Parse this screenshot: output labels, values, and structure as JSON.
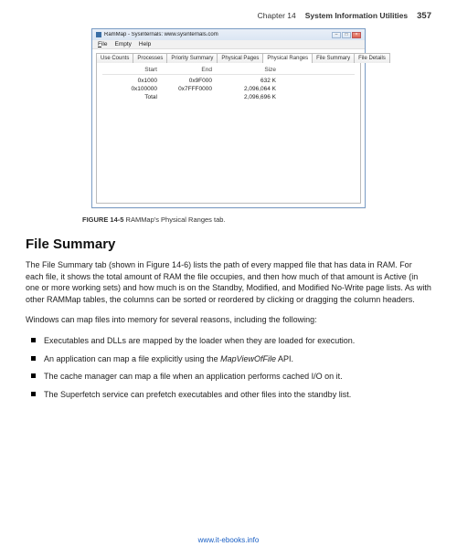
{
  "header": {
    "chapter": "Chapter 14",
    "title": "System Information Utilities",
    "page": "357"
  },
  "app": {
    "title": "RamMap - Sysinternals: www.sysinternals.com",
    "menus": {
      "file": "File",
      "empty": "Empty",
      "help": "Help"
    },
    "tabs": {
      "use_counts": "Use Counts",
      "processes": "Processes",
      "priority_summary": "Priority Summary",
      "physical_pages": "Physical Pages",
      "physical_ranges": "Physical Ranges",
      "file_summary": "File Summary",
      "file_details": "File Details"
    },
    "table": {
      "headers": {
        "start": "Start",
        "end": "End",
        "size": "Size"
      },
      "rows": [
        {
          "start": "0x1000",
          "end": "0x9F000",
          "size": "632 K"
        },
        {
          "start": "0x100000",
          "end": "0x7FFF0000",
          "size": "2,096,064 K"
        },
        {
          "start": "Total",
          "end": "",
          "size": "2,096,696 K"
        }
      ]
    }
  },
  "caption": {
    "label": "FIGURE 14-5",
    "text": " RAMMap's Physical Ranges tab."
  },
  "section": {
    "heading": "File Summary",
    "p1": "The File Summary tab (shown in Figure 14-6) lists the path of every mapped file that has data in RAM. For each file, it shows the total amount of RAM the file occupies, and then how much of that amount is Active (in one or more working sets) and how much is on the Standby, Modified, and Modified No-Write page lists. As with other RAMMap tables, the columns can be sorted or reordered by clicking or dragging the column headers.",
    "p2": "Windows can map files into memory for several reasons, including the following:",
    "bullets": {
      "b1": "Executables and DLLs are mapped by the loader when they are loaded for execution.",
      "b2_pre": "An application can map a file explicitly using the ",
      "b2_em": "MapViewOfFile",
      "b2_post": " API.",
      "b3": "The cache manager can map a file when an application performs cached I/O on it.",
      "b4": "The Superfetch service can prefetch executables and other files into the standby list."
    }
  },
  "footer": {
    "link": "www.it-ebooks.info"
  }
}
